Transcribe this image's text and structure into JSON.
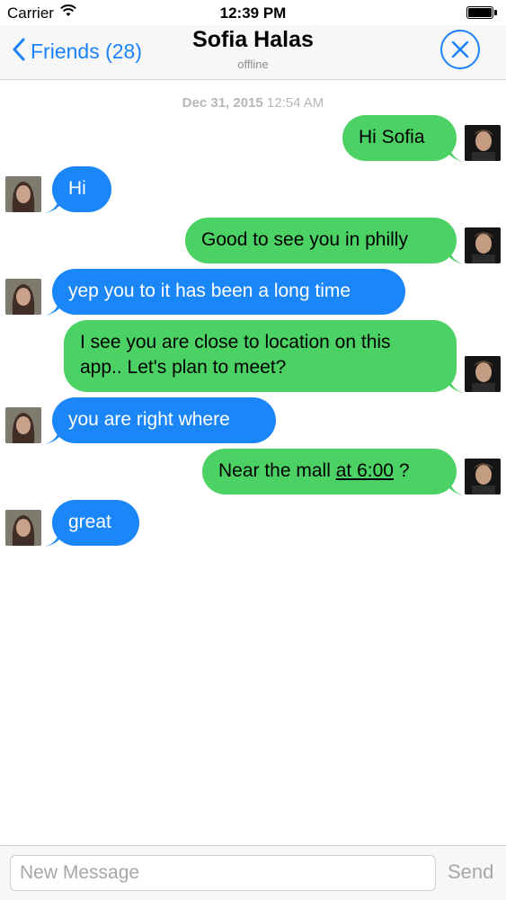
{
  "status_bar": {
    "carrier": "Carrier",
    "time": "12:39 PM",
    "icons": [
      "wifi-icon",
      "battery-icon"
    ]
  },
  "nav": {
    "back_label": "Friends (28)",
    "title": "Sofia Halas",
    "subtitle": "offline",
    "icons": [
      "chevron-left-icon",
      "close-icon"
    ],
    "accent_color": "#1a82fb"
  },
  "conversation": {
    "timestamp_date": "Dec 31, 2015",
    "timestamp_time": "12:54 AM",
    "outgoing_color": "#4cd164",
    "incoming_color": "#1a86f7",
    "messages": [
      {
        "sender": "me",
        "text": "Hi Sofia"
      },
      {
        "sender": "sofia",
        "text": "Hi"
      },
      {
        "sender": "me",
        "text": "Good to see you in philly"
      },
      {
        "sender": "sofia",
        "text": "yep you to it has been a long time"
      },
      {
        "sender": "me",
        "text_line1": "I see you are close to location on this",
        "text_line2": "app.. Let's plan to meet?"
      },
      {
        "sender": "sofia",
        "text": "you are right where"
      },
      {
        "sender": "me",
        "text_prefix": "Near the mall",
        "text_link": "at 6:00",
        "text_suffix": "?"
      },
      {
        "sender": "sofia",
        "text": "great"
      }
    ]
  },
  "composer": {
    "placeholder": "New Message",
    "value": "",
    "send_label": "Send"
  }
}
